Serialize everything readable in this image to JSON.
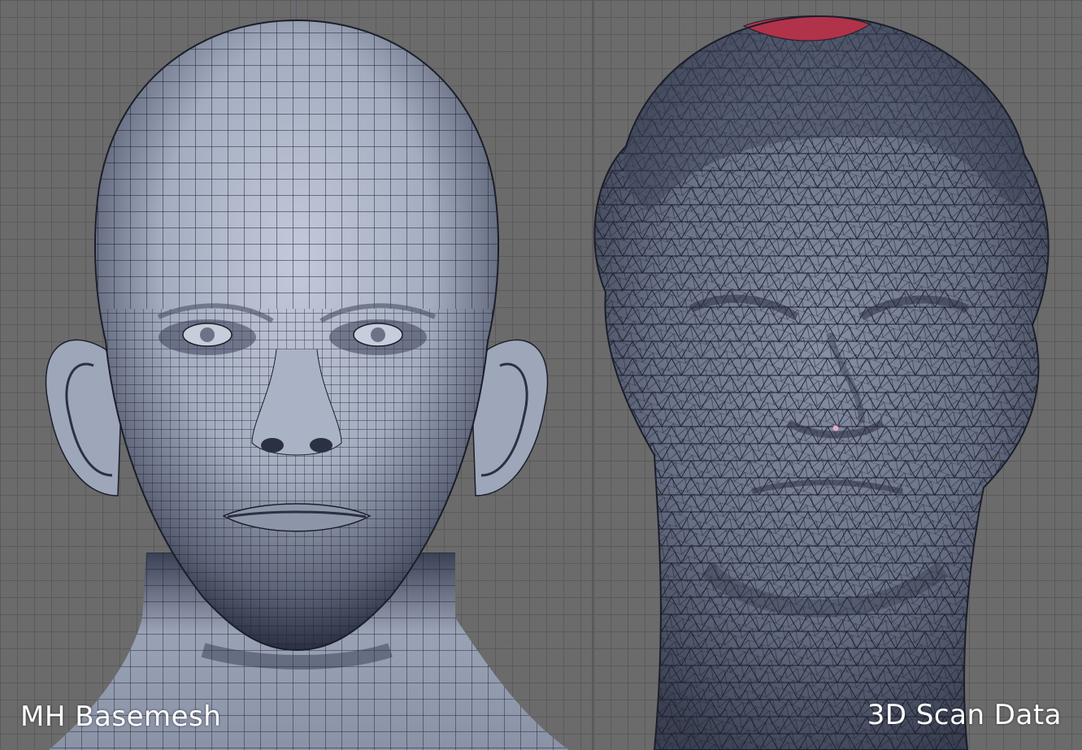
{
  "labels": {
    "left": "MH Basemesh",
    "right": "3D Scan Data"
  },
  "colors": {
    "background": "#6b6b6b",
    "grid": "#4e4e4e",
    "skin_light": "#b9c0d2",
    "skin_dark": "#2a3042",
    "wire": "#1a1d28",
    "scan_top": "#b0334a"
  }
}
